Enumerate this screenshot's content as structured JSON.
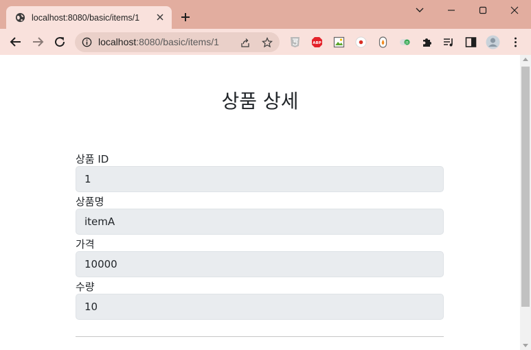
{
  "browser": {
    "tab_title": "localhost:8080/basic/items/1",
    "url_host": "localhost",
    "url_path": ":8080/basic/items/1",
    "colors": {
      "titlebar": "#e2ad9f",
      "toolbar": "#f9e1dc",
      "omnibox": "#ead0c9"
    },
    "extensions": [
      "html5-icon",
      "adblock-icon",
      "image-icon",
      "record-icon",
      "fire-icon",
      "js-icon",
      "puzzle-icon",
      "media-icon",
      "sidepanel-icon",
      "profile-icon",
      "menu-icon"
    ]
  },
  "page": {
    "title": "상품 상세",
    "fields": [
      {
        "label": "상품 ID",
        "value": "1"
      },
      {
        "label": "상품명",
        "value": "itemA"
      },
      {
        "label": "가격",
        "value": "10000"
      },
      {
        "label": "수량",
        "value": "10"
      }
    ],
    "colors": {
      "input_bg": "#e9ecef",
      "input_border": "#dee2e6",
      "text": "#212529"
    }
  }
}
